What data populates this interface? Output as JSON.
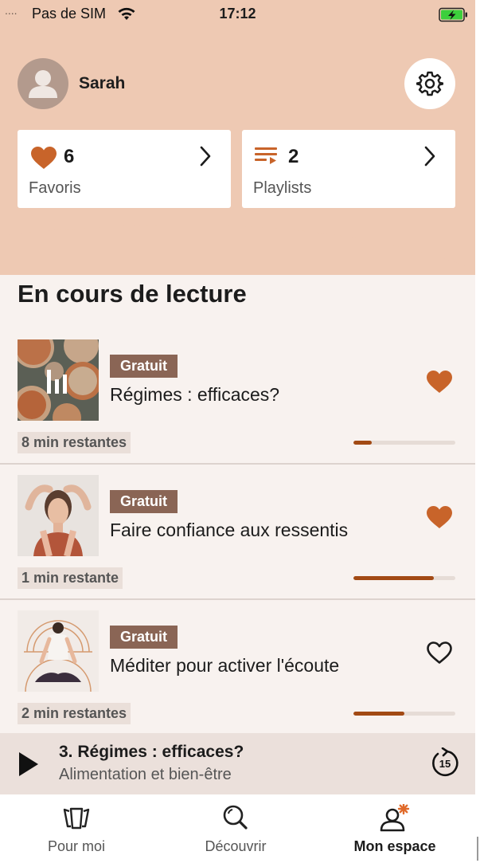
{
  "status_bar": {
    "signal": "....",
    "carrier": "Pas de SIM",
    "time": "17:12"
  },
  "profile": {
    "name": "Sarah"
  },
  "cards": [
    {
      "count": "6",
      "label": "Favoris",
      "icon": "heart-icon"
    },
    {
      "count": "2",
      "label": "Playlists",
      "icon": "playlist-icon"
    }
  ],
  "section_title": "En cours de lecture",
  "items": [
    {
      "badge": "Gratuit",
      "title": "Régimes : efficaces?",
      "remaining": "8 min restantes",
      "progress": 0.18,
      "favorite": true,
      "playing": true
    },
    {
      "badge": "Gratuit",
      "title": "Faire confiance aux ressentis",
      "remaining": "1 min restante",
      "progress": 0.79,
      "favorite": true,
      "playing": false
    },
    {
      "badge": "Gratuit",
      "title": "Méditer pour activer l'écoute",
      "remaining": "2 min restantes",
      "progress": 0.5,
      "favorite": false,
      "playing": false
    }
  ],
  "now_playing": {
    "title": "3. Régimes : efficaces?",
    "subtitle": "Alimentation et bien-être",
    "replay_seconds": "15"
  },
  "tabs": [
    {
      "label": "Pour moi",
      "icon": "cards-icon",
      "active": false
    },
    {
      "label": "Découvrir",
      "icon": "search-icon",
      "active": false
    },
    {
      "label": "Mon espace",
      "icon": "profile-icon",
      "active": true
    }
  ],
  "colors": {
    "header": "#eec9b3",
    "accent": "#c8642a",
    "badge": "#8a6555",
    "progress": "#a24a14",
    "background": "#f8f2ef"
  }
}
